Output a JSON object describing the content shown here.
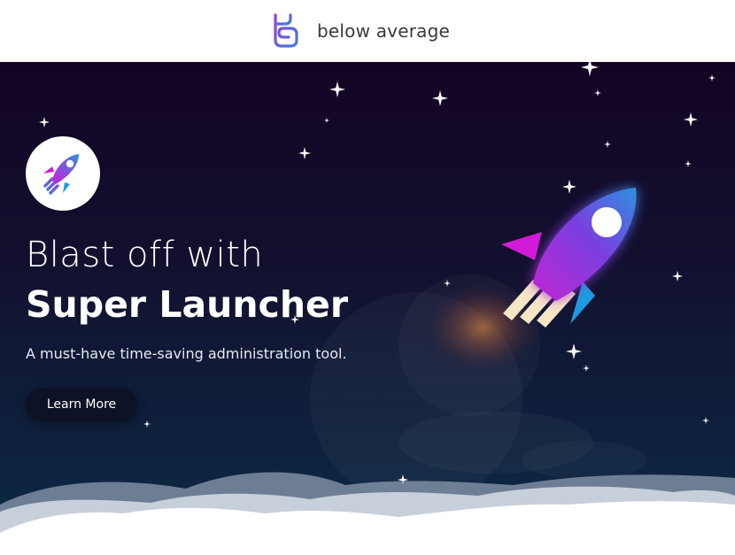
{
  "header": {
    "brand_name": "below average",
    "logo_icon": "ba-monogram-icon",
    "colors": {
      "logo_start": "#9b3be0",
      "logo_end": "#3b7fd9"
    }
  },
  "hero": {
    "app_icon": "rocket-icon",
    "headline_line1": "Blast off with",
    "headline_line2": "Super Launcher",
    "tagline": "A must-have time-saving administration tool.",
    "cta_label": "Learn More",
    "illustration_icon": "rocket-illustration-icon",
    "colors": {
      "background_top": "#140424",
      "background_bottom": "#0b2c45",
      "rocket_start": "#c026d3",
      "rocket_end": "#2f8fe0",
      "fin_blue": "#1d9be0",
      "fin_magenta": "#d21bd6",
      "flame": "#f5e6c6",
      "cloud_front": "#ffffff",
      "cloud_mid": "#c7cfda",
      "cloud_back": "#8e9bb0"
    }
  }
}
